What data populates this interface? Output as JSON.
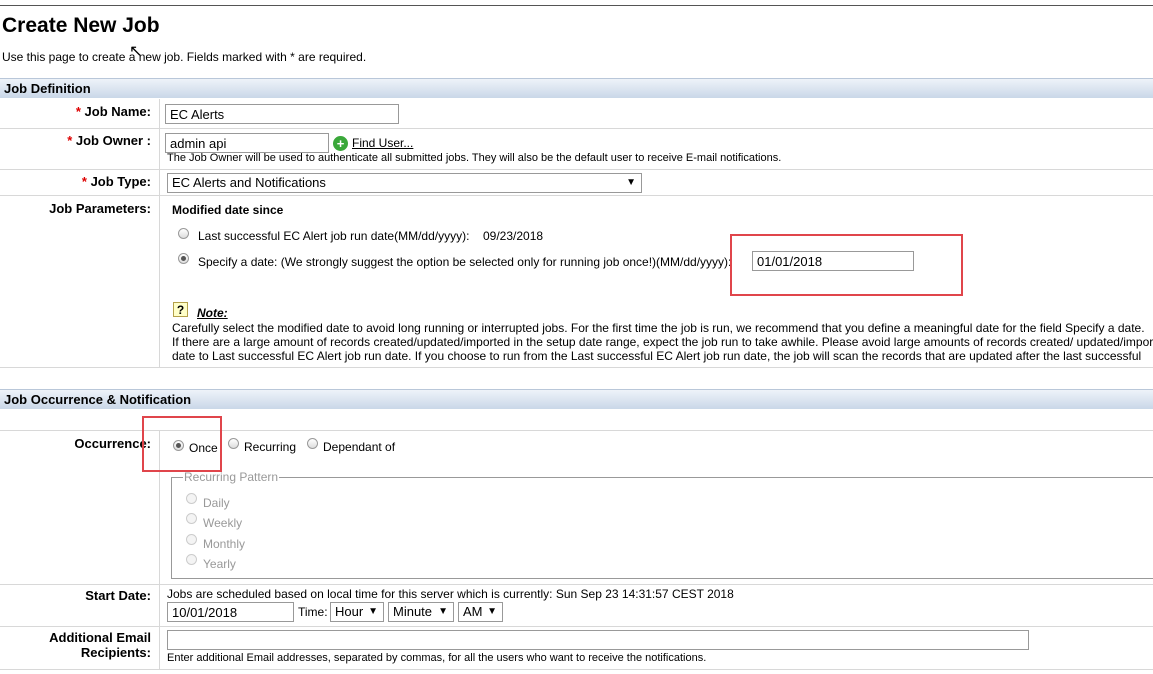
{
  "page": {
    "title": "Create New Job",
    "intro": "Use this page to create a new job. Fields marked with * are required."
  },
  "sections": {
    "definition": "Job Definition",
    "occurrence": "Job Occurrence & Notification"
  },
  "job_name": {
    "label": "Job Name:",
    "value": "EC Alerts"
  },
  "job_owner": {
    "label": "Job Owner :",
    "value": "admin api",
    "find_user": "Find User...",
    "help": "The Job Owner will be used to authenticate all submitted jobs. They will also be the default user to receive E-mail notifications."
  },
  "job_type": {
    "label": "Job Type:",
    "value": "EC Alerts and Notifications"
  },
  "job_parameters": {
    "label": "Job Parameters:",
    "heading": "Modified date since",
    "option_last": "Last successful EC Alert job run date(MM/dd/yyyy):",
    "last_date": "09/23/2018",
    "option_specify": "Specify a date: (We strongly suggest the option be selected only for running job once!)(MM/dd/yyyy):",
    "specify_value": "01/01/2018",
    "note_title": "Note:",
    "note_line1": "Carefully select the modified date to avoid long running or interrupted jobs. For the first time the job is run, we recommend that you define a meaningful date for the field Specify a date.",
    "note_line2": "If there are a large amount of records created/updated/imported in the setup date range, expect the job run to take awhile. Please avoid large amounts of records created/ updated/imported",
    "note_line3": "date to Last successful EC Alert job run date. If you choose to run from the Last successful EC Alert job run date, the job will scan the records that are updated after the last successful"
  },
  "occurrence": {
    "label": "Occurrence:",
    "once": "Once",
    "recurring": "Recurring",
    "dependant": "Dependant of",
    "pattern_legend": "Recurring Pattern",
    "daily": "Daily",
    "weekly": "Weekly",
    "monthly": "Monthly",
    "yearly": "Yearly"
  },
  "start_date": {
    "label": "Start Date:",
    "info": "Jobs are scheduled based on local time for this server which is currently: Sun Sep 23 14:31:57 CEST 2018",
    "value": "10/01/2018",
    "time_label": "Time:",
    "hour": "Hour",
    "minute": "Minute",
    "ampm": "AM"
  },
  "email": {
    "label_line1": "Additional Email",
    "label_line2": "Recipients:",
    "value": "",
    "help": "Enter additional Email addresses, separated by commas, for all the users who want to receive the notifications."
  },
  "colors": {
    "highlight_box": "#e0454b",
    "required_star": "#dd0000",
    "header_bg": "#c9d7e8"
  }
}
